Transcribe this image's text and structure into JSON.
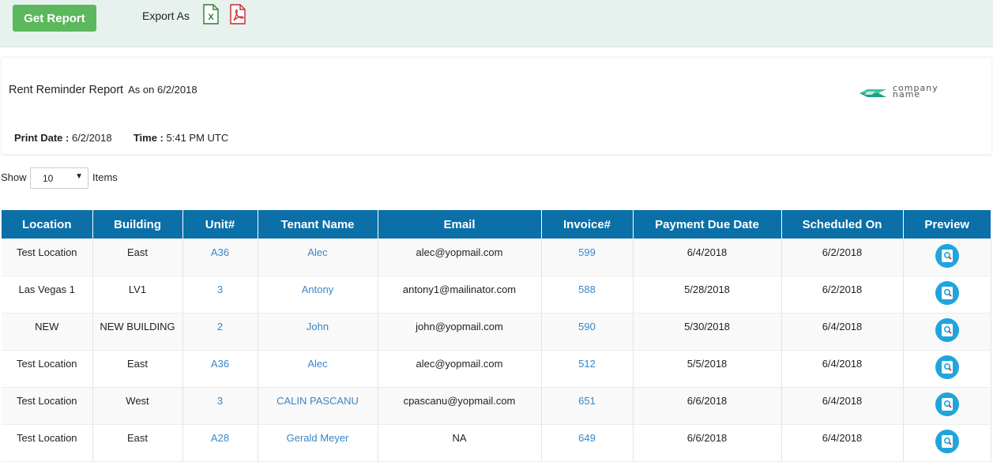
{
  "toolbar": {
    "get_report_label": "Get Report",
    "export_label": "Export As",
    "excel_icon": "excel-file-icon",
    "pdf_icon": "pdf-file-icon"
  },
  "report": {
    "title": "Rent Reminder Report",
    "as_on": "As on 6/2/2018",
    "print_date_label": "Print Date :",
    "print_date": "6/2/2018",
    "time_label": "Time :",
    "time": "5:41 PM UTC",
    "logo_text_1": "company",
    "logo_text_2": "name"
  },
  "pager": {
    "show_label": "Show",
    "selected": "10",
    "items_label": "Items"
  },
  "table": {
    "headers": [
      "Location",
      "Building",
      "Unit#",
      "Tenant Name",
      "Email",
      "Invoice#",
      "Payment Due Date",
      "Scheduled On",
      "Preview"
    ],
    "rows": [
      {
        "location": "Test Location",
        "building": "East",
        "unit": "A36",
        "tenant": "Alec",
        "email": "alec@yopmail.com",
        "invoice": "599",
        "due": "6/4/2018",
        "scheduled": "6/2/2018"
      },
      {
        "location": "Las Vegas 1",
        "building": "LV1",
        "unit": "3",
        "tenant": "Antony",
        "email": "antony1@mailinator.com",
        "invoice": "588",
        "due": "5/28/2018",
        "scheduled": "6/2/2018"
      },
      {
        "location": "NEW",
        "building": "NEW BUILDING",
        "unit": "2",
        "tenant": "John",
        "email": "john@yopmail.com",
        "invoice": "590",
        "due": "5/30/2018",
        "scheduled": "6/4/2018"
      },
      {
        "location": "Test Location",
        "building": "East",
        "unit": "A36",
        "tenant": "Alec",
        "email": "alec@yopmail.com",
        "invoice": "512",
        "due": "5/5/2018",
        "scheduled": "6/4/2018"
      },
      {
        "location": "Test Location",
        "building": "West",
        "unit": "3",
        "tenant": "CALIN PASCANU",
        "email": "cpascanu@yopmail.com",
        "invoice": "651",
        "due": "6/6/2018",
        "scheduled": "6/4/2018"
      },
      {
        "location": "Test Location",
        "building": "East",
        "unit": "A28",
        "tenant": "Gerald Meyer",
        "email": "NA",
        "invoice": "649",
        "due": "6/6/2018",
        "scheduled": "6/4/2018"
      }
    ],
    "preview_icon": "preview-search-icon"
  },
  "colors": {
    "header_bg": "#0b6fa8",
    "button_green": "#5cb85c",
    "link": "#3a86c8",
    "topbar_bg": "#e7f1ed"
  }
}
